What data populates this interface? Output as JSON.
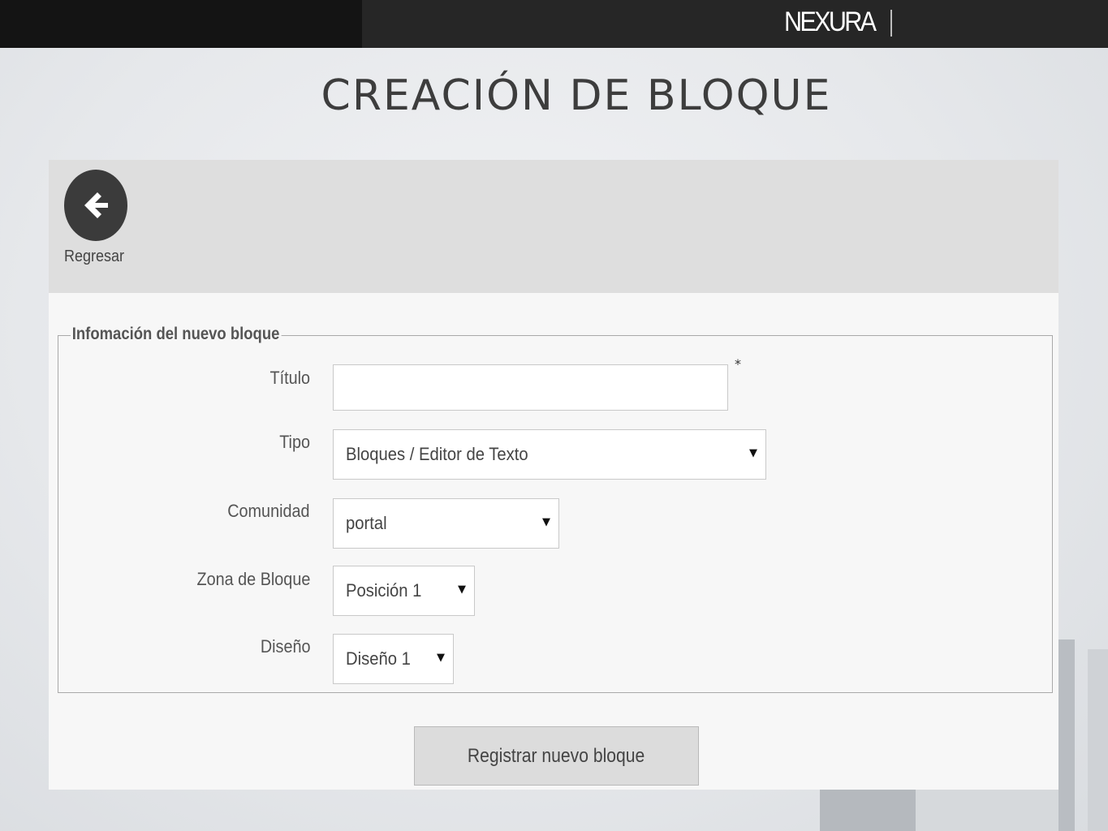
{
  "brand": {
    "logo_text": "NEXURA"
  },
  "slide": {
    "title": "CREACIÓN DE BLOQUE"
  },
  "toolbar": {
    "back_label": "Regresar"
  },
  "form": {
    "legend": "Infomación del nuevo bloque",
    "required_marker": "*",
    "fields": {
      "titulo": {
        "label": "Título",
        "value": ""
      },
      "tipo": {
        "label": "Tipo",
        "value": "Bloques / Editor de Texto"
      },
      "comunidad": {
        "label": "Comunidad",
        "value": "portal"
      },
      "zona": {
        "label": "Zona de Bloque",
        "value": "Posición 1"
      },
      "diseno": {
        "label": "Diseño",
        "value": "Diseño 1"
      }
    },
    "dropdown_arrow": "▼",
    "submit_label": "Registrar nuevo bloque"
  },
  "colors": {
    "topbar": "#262626",
    "panel_header": "#dedede",
    "back_button": "#3b3b3b",
    "title_text": "#3d3d3d"
  },
  "icons": {
    "back": "arrow-left-icon",
    "dropdown": "caret-down-icon"
  }
}
